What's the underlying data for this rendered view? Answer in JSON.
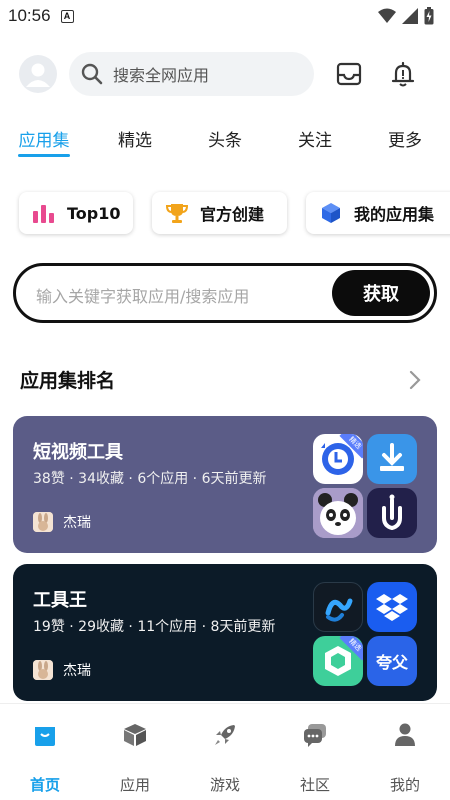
{
  "status_bar": {
    "time": "10:56",
    "notif_glyph": "A"
  },
  "header": {
    "search_placeholder": "搜索全网应用"
  },
  "tabs": [
    {
      "label": "应用集",
      "active": true
    },
    {
      "label": "精选"
    },
    {
      "label": "头条"
    },
    {
      "label": "关注"
    },
    {
      "label": "更多"
    }
  ],
  "chips": [
    {
      "label": "Top10",
      "icon": "bar-chart-icon"
    },
    {
      "label": "官方创建",
      "icon": "trophy-icon"
    },
    {
      "label": "我的应用集",
      "icon": "cube-icon"
    }
  ],
  "keyword": {
    "placeholder": "输入关键字获取应用/搜索应用",
    "button": "获取"
  },
  "section": {
    "title": "应用集排名"
  },
  "collections": [
    {
      "title": "短视频工具",
      "meta": "38赞 · 34收藏 · 6个应用 · 6天前更新",
      "author": "杰瑞",
      "bg": "#5b5c87",
      "apps": [
        "clock-app-icon",
        "download-app-icon",
        "panda-app-icon",
        "hand-app-icon"
      ]
    },
    {
      "title": "工具王",
      "meta": "19赞 · 29收藏 · 11个应用 · 8天前更新",
      "author": "杰瑞",
      "bg": "#0c1b28",
      "apps": [
        "wave-app-icon",
        "dropbox-app-icon",
        "green-box-app-icon",
        "kuafu-app-icon"
      ],
      "app_text": "夸父"
    }
  ],
  "bottom_nav": [
    {
      "label": "首页",
      "icon": "home-bag-icon",
      "active": true
    },
    {
      "label": "应用",
      "icon": "box-icon"
    },
    {
      "label": "游戏",
      "icon": "rocket-icon"
    },
    {
      "label": "社区",
      "icon": "chat-icon"
    },
    {
      "label": "我的",
      "icon": "person-icon"
    }
  ],
  "accent_color": "#18a0ea"
}
